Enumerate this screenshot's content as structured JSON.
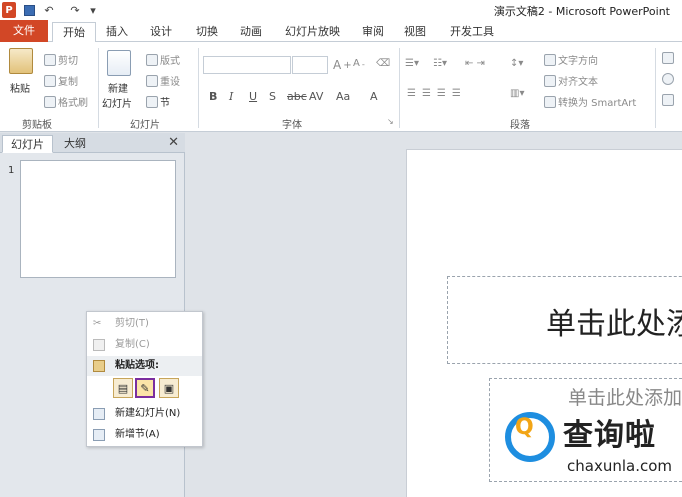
{
  "quick_access": {
    "app_icon": "P",
    "save_icon": "save-icon",
    "undo": "↶",
    "redo": "↷"
  },
  "window": {
    "title": "演示文稿2 - Microsoft PowerPoint"
  },
  "tabs": [
    {
      "label": "文件"
    },
    {
      "label": "开始"
    },
    {
      "label": "插入"
    },
    {
      "label": "设计"
    },
    {
      "label": "切换"
    },
    {
      "label": "动画"
    },
    {
      "label": "幻灯片放映"
    },
    {
      "label": "审阅"
    },
    {
      "label": "视图"
    },
    {
      "label": "开发工具"
    }
  ],
  "ribbon": {
    "clipboard": {
      "label": "剪贴板",
      "paste": "粘贴",
      "cut": "剪切",
      "copy": "复制",
      "format_painter": "格式刷"
    },
    "slides": {
      "label": "幻灯片",
      "new_slide_1": "新建",
      "new_slide_2": "幻灯片",
      "layout": "版式",
      "reset": "重设",
      "section": "节"
    },
    "font": {
      "label": "字体",
      "bold": "B",
      "italic": "I",
      "underline": "U",
      "strike": "S",
      "abc": "abc",
      "av": "AV",
      "aa": "Aa",
      "a": "A"
    },
    "paragraph": {
      "label": "段落",
      "text_direction": "文字方向",
      "align_text": "对齐文本",
      "smartart": "转换为 SmartArt"
    }
  },
  "panel": {
    "tab_slides": "幻灯片",
    "tab_outline": "大纲",
    "close": "✕",
    "slide_number": "1"
  },
  "context_menu": {
    "cut": "剪切(T)",
    "copy": "复制(C)",
    "paste_options": "粘贴选项:",
    "new_slide": "新建幻灯片(N)",
    "new_section": "新增节(A)"
  },
  "slide": {
    "title_placeholder": "单击此处添加标题",
    "subtitle_placeholder": "单击此处添加副标题"
  },
  "watermark": {
    "text": "查询啦",
    "url": "chaxunla.com"
  }
}
